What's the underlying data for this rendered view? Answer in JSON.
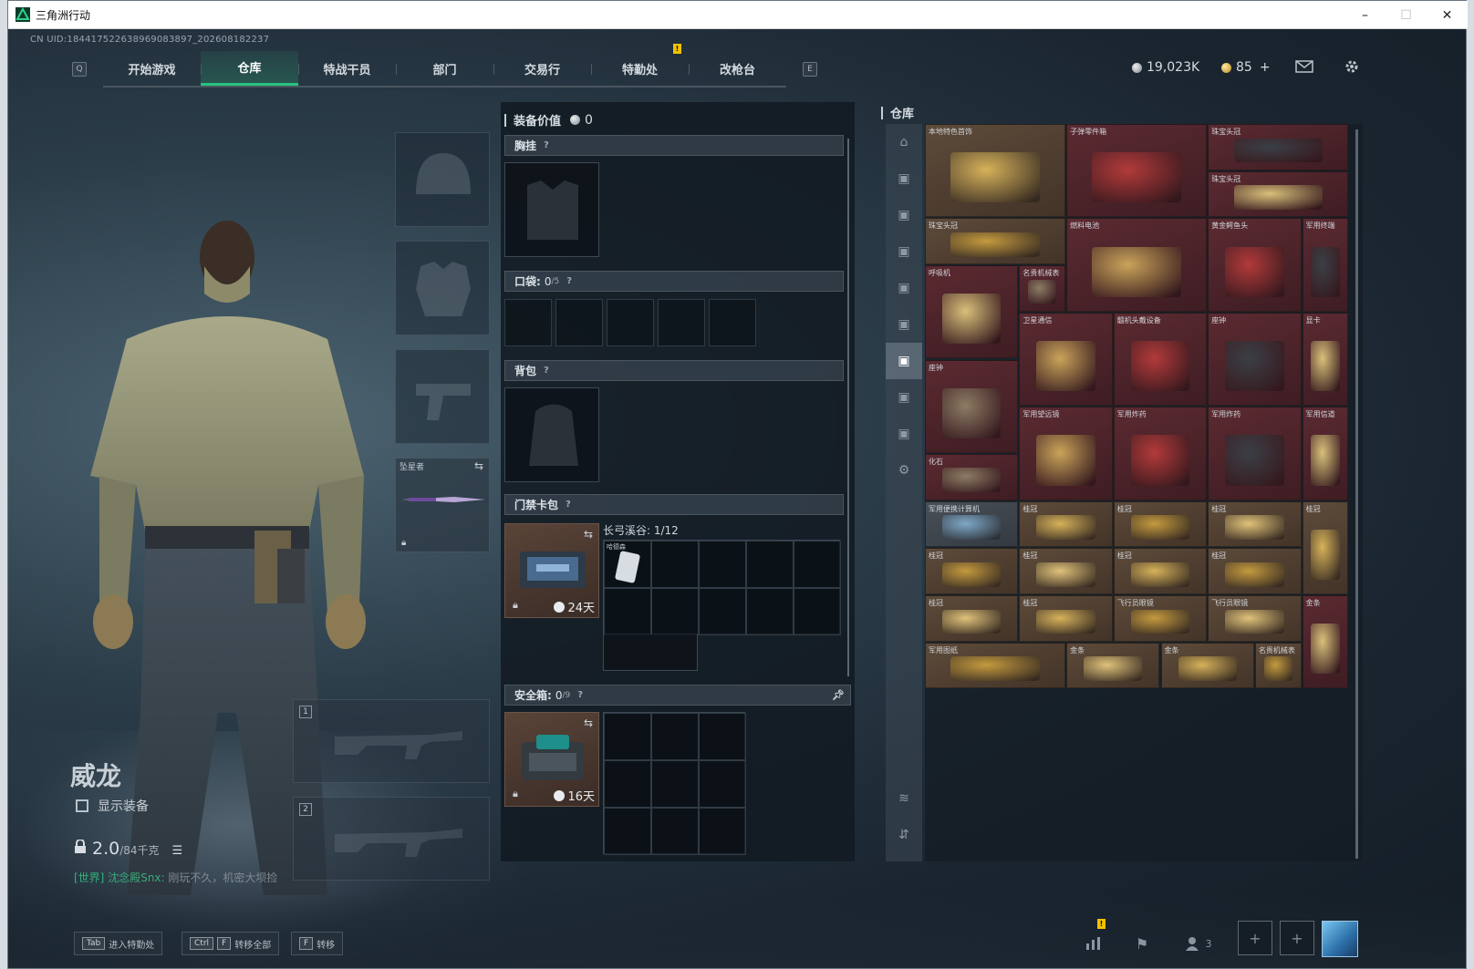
{
  "window": {
    "title": "三角洲行动",
    "minimize": "–",
    "maximize": "☐",
    "close": "✕"
  },
  "uid": "CN UID:18441752263896908​3897_202608182237",
  "nav": {
    "left_key": "Q",
    "right_key": "E",
    "tabs": [
      {
        "label": "开始游戏"
      },
      {
        "label": "仓库",
        "active": true
      },
      {
        "label": "特战干员"
      },
      {
        "label": "部门"
      },
      {
        "label": "交易行"
      },
      {
        "label": "特勤处",
        "warning": "!"
      },
      {
        "label": "改枪台"
      }
    ]
  },
  "currency": {
    "silver": "19,023K",
    "gold": "85",
    "gold_add": "+"
  },
  "character": {
    "name": "威龙",
    "show_equipment_label": "显示装备",
    "weight_value": "2.0",
    "weight_max": "/84千克",
    "chat_channel": "[世界]",
    "chat_name": "沈念殿Snx:",
    "chat_text": "刚玩不久，机密大坝捡"
  },
  "gear": {
    "melee_label": "坠星者",
    "weapon_slot_1": "1",
    "weapon_slot_2": "2"
  },
  "equipment": {
    "title": "装备价值",
    "value": "0",
    "chest_rig": "胸挂",
    "pocket_label": "口袋:",
    "pocket_count": "0",
    "pocket_max": "/5",
    "backpack": "背包",
    "keycard_label": "门禁卡包",
    "keycard_days": "24天",
    "keycard_map": "长弓溪谷: 1/12",
    "keycard_item": "哈德森",
    "safe_label": "安全箱:",
    "safe_count": "0",
    "safe_max": "/9",
    "safe_days": "16天",
    "help": "?"
  },
  "warehouse": {
    "title": "仓库",
    "items": [
      {
        "label": "本地特色首饰",
        "tone": "gold"
      },
      {
        "label": "子弹零件箱",
        "tone": "red"
      },
      {
        "label": "珠宝头冠",
        "tone": "red"
      },
      {
        "label": "珠宝头冠",
        "tone": "red"
      },
      {
        "label": "珠宝头冠",
        "tone": "gold"
      },
      {
        "label": "燃料电池",
        "tone": "red"
      },
      {
        "label": "黄金鳄鱼头",
        "tone": "red"
      },
      {
        "label": "军用终端",
        "tone": "red"
      },
      {
        "label": "呼吸机",
        "tone": "red"
      },
      {
        "label": "名贵机械表",
        "tone": "red"
      },
      {
        "label": "卫星通信",
        "tone": "red"
      },
      {
        "label": "髓机头戴设备",
        "tone": "red"
      },
      {
        "label": "座钟",
        "tone": "red"
      },
      {
        "label": "显卡",
        "tone": "red"
      },
      {
        "label": "座钟",
        "tone": "red"
      },
      {
        "label": "军用望远镜",
        "tone": "red"
      },
      {
        "label": "军用炸药",
        "tone": "red"
      },
      {
        "label": "军用炸药",
        "tone": "red"
      },
      {
        "label": "军用信道",
        "tone": "red"
      },
      {
        "label": "化石",
        "tone": "red"
      },
      {
        "label": "军用便携计算机",
        "tone": "grey"
      },
      {
        "label": "桂冠",
        "tone": "gold"
      },
      {
        "label": "桂冠",
        "tone": "gold"
      },
      {
        "label": "桂冠",
        "tone": "gold"
      },
      {
        "label": "桂冠",
        "tone": "gold"
      },
      {
        "label": "桂冠",
        "tone": "gold"
      },
      {
        "label": "桂冠",
        "tone": "gold"
      },
      {
        "label": "桂冠",
        "tone": "gold"
      },
      {
        "label": "桂冠",
        "tone": "gold"
      },
      {
        "label": "桂冠",
        "tone": "gold"
      },
      {
        "label": "桂冠",
        "tone": "gold"
      },
      {
        "label": "飞行员眼镜",
        "tone": "gold"
      },
      {
        "label": "飞行员眼镜",
        "tone": "gold"
      },
      {
        "label": "金条",
        "tone": "red"
      },
      {
        "label": "军用图纸",
        "tone": "gold"
      },
      {
        "label": "金条",
        "tone": "gold"
      },
      {
        "label": "金条",
        "tone": "gold"
      },
      {
        "label": "名贵机械表",
        "tone": "gold"
      }
    ]
  },
  "bottom": {
    "hint1_key": "Tab",
    "hint1_text": "进入特勤处",
    "hint2_key1": "Ctrl",
    "hint2_key2": "F",
    "hint2_text": "转移全部",
    "hint3_key": "F",
    "hint3_text": "转移",
    "friends_count": "3",
    "warning": "!"
  },
  "colors": {
    "accent": "#27c27f",
    "warning": "#f2c200",
    "item_red": "#5b2a31",
    "item_gold": "#5d4a3a"
  }
}
